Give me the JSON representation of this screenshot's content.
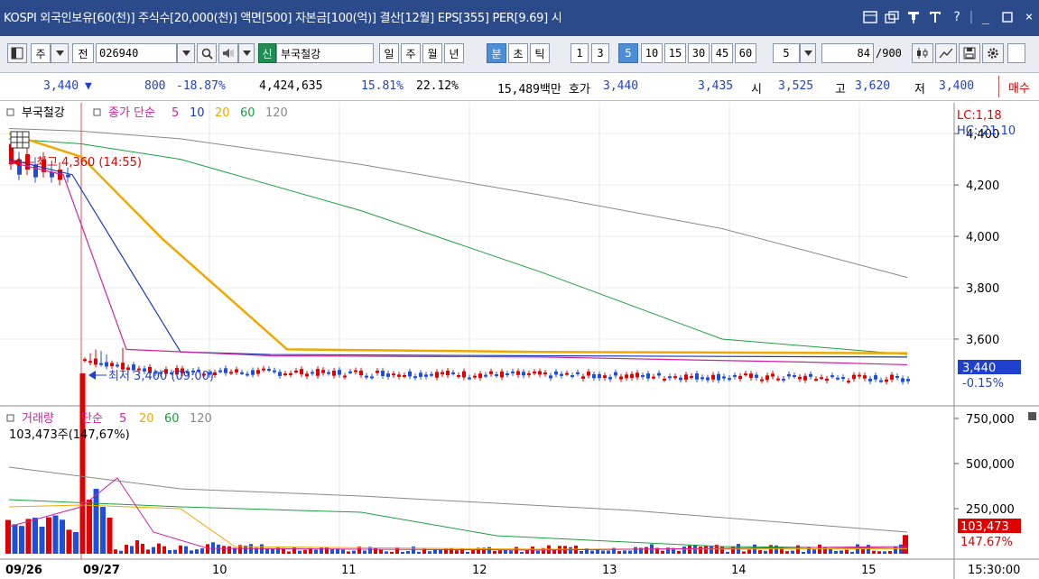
{
  "titlebar": {
    "text": "KOSPI 외국인보유[60(천)] 주식수[20,000(천)] 액면[500] 자본금[100(억)] 결산[12월] EPS[355] PER[9.69] 시",
    "icons": [
      "window-icon",
      "popup-icon",
      "pin-icon",
      "text-icon",
      "help-icon",
      "minimize-icon",
      "close-icon"
    ],
    "help": "?",
    "minimize": "_",
    "close": "×"
  },
  "toolbar": {
    "mode": "주",
    "prev": "전",
    "code": "026940",
    "shin": "신",
    "name": "부국철강",
    "periods": [
      "일",
      "주",
      "월",
      "년",
      "분",
      "초",
      "틱"
    ],
    "selected_period": "분",
    "intervals": [
      "1",
      "3",
      "5",
      "10",
      "15",
      "30",
      "45",
      "60"
    ],
    "selected_interval": "5",
    "select_value": "5",
    "count": "84",
    "count_total": "/900"
  },
  "quote": {
    "price": "3,440",
    "down_arrow": "▼",
    "change": "800",
    "change_rate": "-18.87%",
    "volume": "4,424,635",
    "rate1": "15.81%",
    "rate2": "22.12%",
    "amount": "15,489백만",
    "hoga_label": "호가",
    "ask": "3,440",
    "bid": "3,435",
    "open_label": "시",
    "open": "3,525",
    "high_label": "고",
    "high": "3,620",
    "low_label": "저",
    "low": "3,400",
    "buy_button": "매수"
  },
  "price_chart": {
    "legend": {
      "icon": "□",
      "name": "부국철강",
      "icon2": "□",
      "ma_label": "종가 단순",
      "ma": [
        "5",
        "10",
        "20",
        "60",
        "120"
      ]
    },
    "lc": "LC:1,18",
    "hc": "HC:-21,10",
    "high_annotation": "최고 4,360 (14:55)",
    "low_annotation": "최저 3,400 (09:00)",
    "current_price": "3,440",
    "current_rate": "-0.15%"
  },
  "volume_chart": {
    "legend": {
      "icon": "□",
      "name": "거래량",
      "ma_label": "단순",
      "ma": [
        "5",
        "20",
        "60",
        "120"
      ]
    },
    "value_line": "103,473주(147,67%)",
    "current_value": "103,473",
    "current_rate": "147.67%"
  },
  "x_axis": {
    "labels": [
      "09/26",
      "09/27",
      "10",
      "11",
      "12",
      "13",
      "14",
      "15"
    ],
    "time": "15:30:00"
  },
  "chart_data": [
    {
      "type": "line",
      "title": "",
      "y_ticks": [
        4400,
        4200,
        4000,
        3800,
        3600
      ],
      "ylim": [
        3340,
        4520
      ],
      "series": [
        {
          "name": "5",
          "color": "#d020a0"
        },
        {
          "name": "10",
          "color": "#1a3ab0"
        },
        {
          "name": "20",
          "color": "#f0a800"
        },
        {
          "name": "60",
          "color": "#1aa040"
        },
        {
          "name": "120",
          "color": "#888888"
        }
      ],
      "ohlc_extremes": {
        "high": 4360,
        "low": 3400,
        "last": 3440
      }
    },
    {
      "type": "bar",
      "title": "",
      "y_ticks": [
        750000,
        500000,
        250000
      ],
      "last_value": 103473
    }
  ],
  "colors": {
    "title_bg": "#2b4a8a",
    "up": "#e10000",
    "down": "#1f4fd8",
    "ma5": "#d020a0",
    "ma10": "#1a3ab0",
    "ma20": "#f0a800",
    "ma60": "#1aa040",
    "ma120": "#888888"
  }
}
